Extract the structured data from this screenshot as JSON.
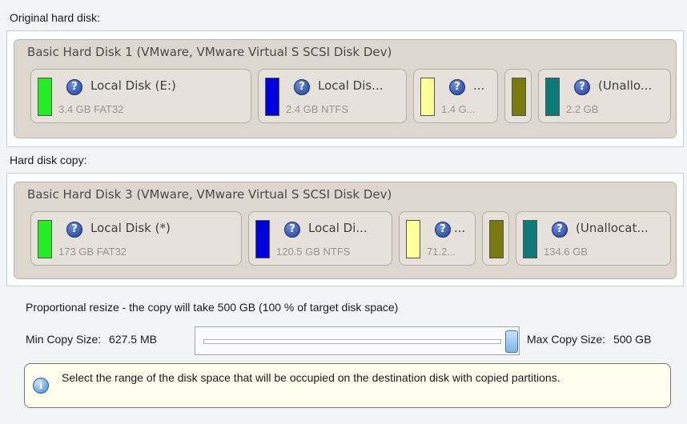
{
  "original": {
    "section_label": "Original hard disk:",
    "disk_title": "Basic Hard Disk 1 (VMware, VMware Virtual S SCSI Disk Dev)",
    "partitions": [
      {
        "name": "Local Disk (E:)",
        "size": "3.4 GB FAT32",
        "color": "#22ee22"
      },
      {
        "name": "Local Dis...",
        "size": "2.4 GB NTFS",
        "color": "#0000dd"
      },
      {
        "name": "...",
        "size": "1.4 G...",
        "color": "#ffff99"
      },
      {
        "name": "",
        "size": "",
        "color": "#7a7a10"
      },
      {
        "name": "(Unallo...",
        "size": "2.2 GB",
        "color": "#0e7a78"
      }
    ]
  },
  "copy": {
    "section_label": "Hard disk copy:",
    "disk_title": "Basic Hard Disk 3 (VMware, VMware Virtual S SCSI Disk Dev)",
    "partitions": [
      {
        "name": "Local Disk (*)",
        "size": "173 GB FAT32",
        "color": "#22ee22"
      },
      {
        "name": "Local Di...",
        "size": "120.5 GB NTFS",
        "color": "#0000dd"
      },
      {
        "name": "...",
        "size": "71.2...",
        "color": "#ffff99"
      },
      {
        "name": "",
        "size": "",
        "color": "#7a7a10"
      },
      {
        "name": "(Unallocat...",
        "size": "134.6 GB",
        "color": "#0e7a78"
      }
    ]
  },
  "resize": {
    "title": "Proportional resize - the copy will take 500 GB (100 % of target disk space)",
    "min_label": "Min Copy Size:",
    "min_value": "627.5 MB",
    "max_label": "Max Copy Size:",
    "max_value": "500 GB",
    "slider_fraction": 1.0,
    "hint": "Select the range of the disk space that will be occupied on the destination disk with copied partitions."
  }
}
